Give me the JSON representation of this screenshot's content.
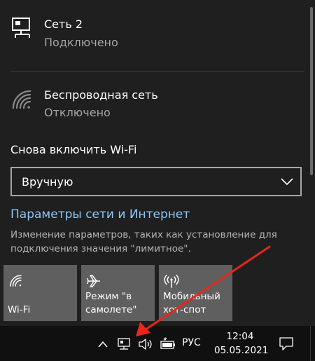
{
  "networks": [
    {
      "name": "Сеть 2",
      "status": "Подключено",
      "icon": "ethernet-icon"
    },
    {
      "name": "Беспроводная сеть",
      "status": "Отключено",
      "icon": "wifi-off-icon"
    }
  ],
  "wifi_reenable": {
    "label": "Снова включить Wi-Fi",
    "selected": "Вручную"
  },
  "settings": {
    "link": "Параметры сети и Интернет",
    "description": "Изменение параметров, таких как установление для подключения значения \"лимитное\"."
  },
  "quick_actions": [
    {
      "label": "Wi-Fi",
      "icon": "wifi-icon"
    },
    {
      "label": "Режим \"в самолете\"",
      "icon": "airplane-icon"
    },
    {
      "label": "Мобильный хот-спот",
      "icon": "hotspot-icon"
    }
  ],
  "taskbar": {
    "lang": "РУС",
    "time": "12:04",
    "date": "05.05.2021"
  },
  "colors": {
    "panel_bg": "#1f1f1f",
    "tile_bg": "#5f5f5f",
    "link": "#8fc6f5",
    "annotation_arrow": "#e8261c"
  }
}
